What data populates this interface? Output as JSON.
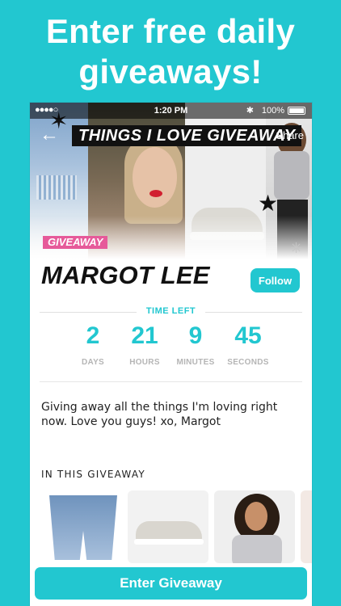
{
  "promo": {
    "line1": "Enter free daily",
    "line2": "giveaways!"
  },
  "statusbar": {
    "signal": "●●●●○",
    "time": "1:20 PM",
    "bluetooth": "✱",
    "battery_pct": "100%"
  },
  "header": {
    "back_icon": "←",
    "banner": "THINGS I LOVE GIVEAWAY",
    "share": "Share"
  },
  "badge": "GIVEAWAY",
  "profile": {
    "name": "MARGOT LEE",
    "follow_label": "Follow"
  },
  "timer": {
    "title": "TIME LEFT",
    "units": [
      {
        "value": "2",
        "label": "DAYS"
      },
      {
        "value": "21",
        "label": "HOURS"
      },
      {
        "value": "9",
        "label": "MINUTES"
      },
      {
        "value": "45",
        "label": "SECONDS"
      }
    ]
  },
  "description": "Giving away all the things I'm loving right now. Love you guys! xo, Margot",
  "section_title": "IN THIS GIVEAWAY",
  "cta_label": "Enter Giveaway",
  "colors": {
    "accent": "#22c7d0",
    "badge": "#e65a9a"
  }
}
